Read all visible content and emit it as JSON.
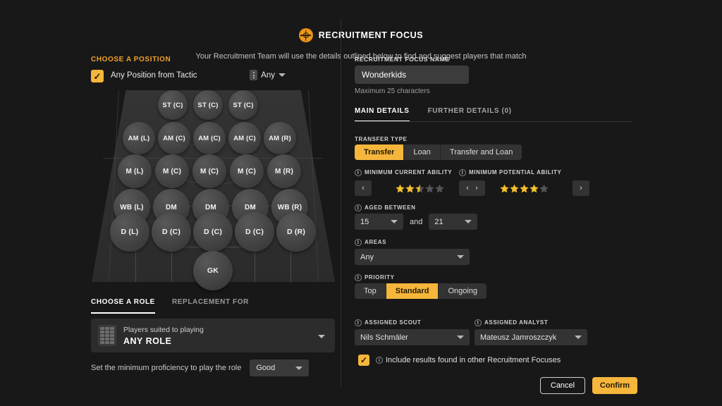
{
  "header": {
    "title": "RECRUITMENT FOCUS",
    "subtitle": "Your Recruitment Team will use the details outlined below to find and suggest players that match",
    "icon": "target-icon"
  },
  "left_panel": {
    "section_title": "CHOOSE A POSITION",
    "any_position_checkbox": {
      "label": "Any Position from Tactic",
      "checked": true
    },
    "position_filter": {
      "value": "Any",
      "icon": "grip-icon"
    },
    "pitch": {
      "rows": [
        {
          "positions": [
            "ST (C)",
            "ST (C)",
            "ST (C)"
          ]
        },
        {
          "positions": [
            "AM (L)",
            "AM (C)",
            "AM (C)",
            "AM (C)",
            "AM (R)"
          ]
        },
        {
          "positions": [
            "M (L)",
            "M (C)",
            "M (C)",
            "M (C)",
            "M (R)"
          ]
        },
        {
          "positions": [
            "WB (L)",
            "DM",
            "DM",
            "DM",
            "WB (R)"
          ]
        },
        {
          "positions": [
            "D (L)",
            "D (C)",
            "D (C)",
            "D (C)",
            "D (R)"
          ]
        },
        {
          "positions": [
            "GK"
          ]
        }
      ]
    },
    "role_tabs": [
      {
        "label": "CHOOSE A ROLE",
        "active": true
      },
      {
        "label": "REPLACEMENT FOR",
        "active": false
      }
    ],
    "role_card": {
      "subtitle": "Players suited to playing",
      "title": "ANY ROLE",
      "icon": "role-grid-icon"
    },
    "proficiency": {
      "label": "Set the minimum proficiency to play the role",
      "value": "Good"
    }
  },
  "right_panel": {
    "focus_name": {
      "label": "RECRUITMENT FOCUS NAME",
      "value": "Wonderkids",
      "placeholder": "Recruitment Focus Name",
      "hint": "Maximum 25 characters"
    },
    "tabs": [
      {
        "label": "MAIN DETAILS",
        "active": true
      },
      {
        "label": "FURTHER DETAILS (0)",
        "active": false
      }
    ],
    "transfer_type": {
      "label": "TRANSFER TYPE",
      "options": [
        {
          "label": "Transfer",
          "selected": true
        },
        {
          "label": "Loan",
          "selected": false
        },
        {
          "label": "Transfer and Loan",
          "selected": false
        }
      ]
    },
    "minimum_current_ability": {
      "label": "MINIMUM CURRENT ABILITY",
      "stars": 2.5,
      "max_stars": 5,
      "prev": "‹",
      "next": "›"
    },
    "minimum_potential_ability": {
      "label": "MINIMUM POTENTIAL ABILITY",
      "stars": 4,
      "max_stars": 5,
      "prev": "‹",
      "next": "›"
    },
    "aged_between": {
      "label": "AGED BETWEEN",
      "from": "15",
      "and_text": "and",
      "to": "21"
    },
    "areas": {
      "label": "AREAS",
      "value": "Any"
    },
    "priority": {
      "label": "PRIORITY",
      "options": [
        {
          "label": "Top",
          "selected": false
        },
        {
          "label": "Standard",
          "selected": true
        },
        {
          "label": "Ongoing",
          "selected": false
        }
      ]
    },
    "assigned_scout": {
      "label": "ASSIGNED SCOUT",
      "value": "Nils Schmäler"
    },
    "assigned_analyst": {
      "label": "ASSIGNED ANALYST",
      "value": "Mateusz Jamroszczyk"
    },
    "include_other_focuses": {
      "label": "Include results found in other Recruitment Focuses",
      "checked": true
    },
    "buttons": {
      "cancel": "Cancel",
      "confirm": "Confirm"
    }
  },
  "colors": {
    "accent": "#f6b63c",
    "accent_text": "#f0a029",
    "background": "#181818",
    "panel": "#333333",
    "star_filled": "#f4c02c",
    "star_empty": "#555555"
  }
}
